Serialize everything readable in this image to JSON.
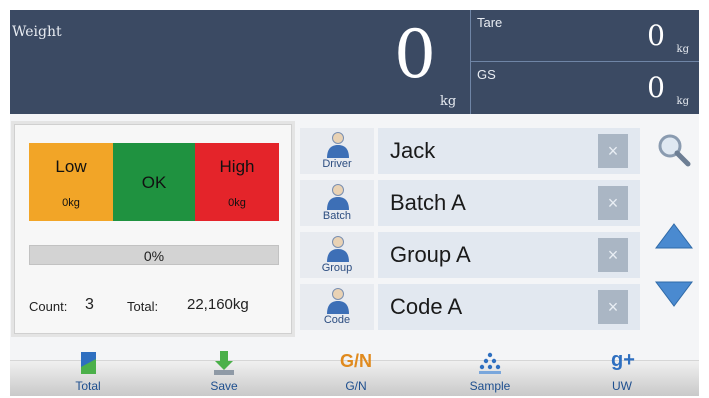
{
  "weight": {
    "label": "Weight",
    "value": "0",
    "unit": "kg"
  },
  "tare": {
    "label": "Tare",
    "value": "0",
    "unit": "kg"
  },
  "gs": {
    "label": "GS",
    "value": "0",
    "unit": "kg"
  },
  "check": {
    "low": {
      "label": "Low",
      "value": "0kg"
    },
    "ok": {
      "label": "OK"
    },
    "high": {
      "label": "High",
      "value": "0kg"
    },
    "progress_text": "0%",
    "progress": 0,
    "count_label": "Count:",
    "count_value": "3",
    "total_label": "Total:",
    "total_value": "22,160kg"
  },
  "rows": [
    {
      "icon": "driver-icon",
      "tag": "Driver",
      "value": "Jack"
    },
    {
      "icon": "batch-icon",
      "tag": "Batch",
      "value": "Batch A"
    },
    {
      "icon": "group-icon",
      "tag": "Group",
      "value": "Group A"
    },
    {
      "icon": "code-icon",
      "tag": "Code",
      "value": "Code A"
    }
  ],
  "clear_glyph": "×",
  "toolbar": [
    {
      "icon": "total-icon",
      "label": "Total"
    },
    {
      "icon": "save-icon",
      "label": "Save"
    },
    {
      "icon": "gn-icon",
      "label": "G/N",
      "glyph": "G/N"
    },
    {
      "icon": "sample-icon",
      "label": "Sample"
    },
    {
      "icon": "uw-icon",
      "label": "UW",
      "glyph": "g+"
    }
  ],
  "colors": {
    "header": "#3b4a63",
    "low": "#f2a527",
    "ok": "#1f9240",
    "high": "#e4242a",
    "accent": "#1e4f8f"
  }
}
